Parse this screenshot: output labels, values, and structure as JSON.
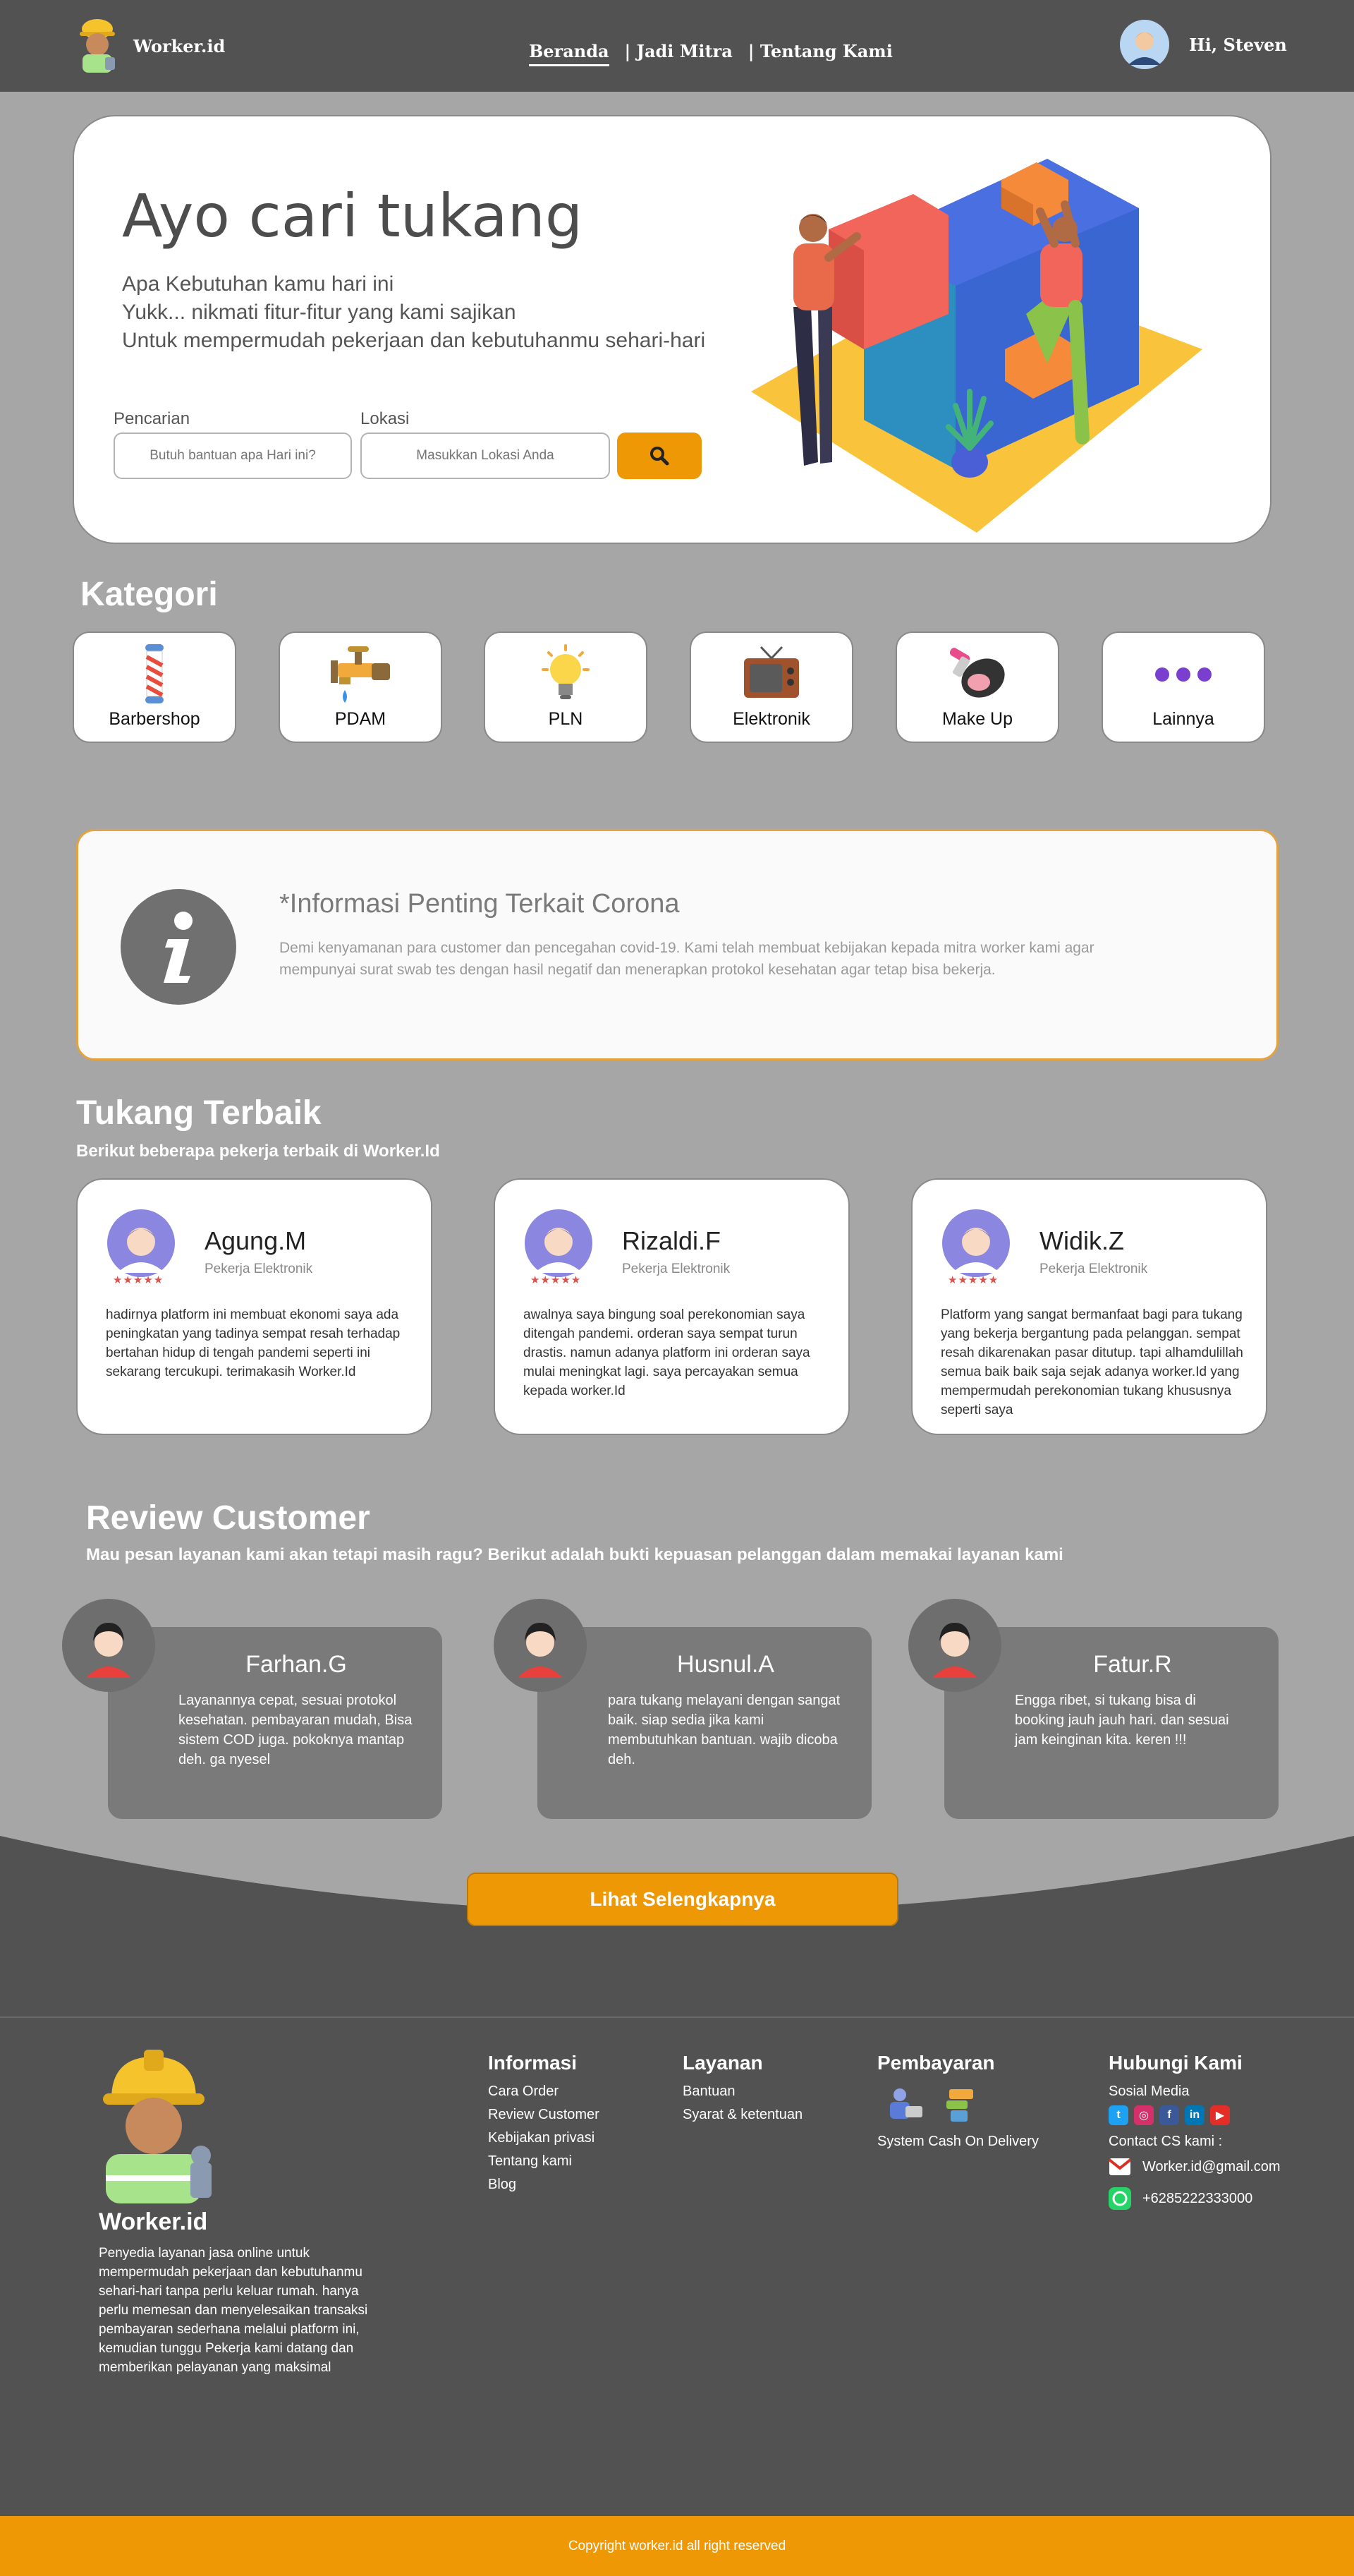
{
  "nav": {
    "brand": "Worker.id",
    "links": [
      "Beranda",
      "| Jadi Mitra",
      "| Tentang Kami"
    ],
    "greeting": "Hi, Steven"
  },
  "hero": {
    "title": "Ayo cari tukang",
    "lines": [
      "Apa Kebutuhan kamu hari ini",
      "Yukk... nikmati fitur-fitur yang kami sajikan",
      "Untuk mempermudah pekerjaan dan kebutuhanmu sehari-hari"
    ],
    "search_label": "Pencarian",
    "location_label": "Lokasi",
    "search_placeholder": "Butuh bantuan apa Hari ini?",
    "location_placeholder": "Masukkan Lokasi Anda",
    "search_button_icon": "search-icon"
  },
  "kategori": {
    "title": "Kategori",
    "items": [
      {
        "label": "Barbershop",
        "icon": "barber-pole-icon"
      },
      {
        "label": "PDAM",
        "icon": "water-tap-icon"
      },
      {
        "label": "PLN",
        "icon": "light-bulb-icon"
      },
      {
        "label": "Elektronik",
        "icon": "television-icon"
      },
      {
        "label": "Make Up",
        "icon": "makeup-icon"
      },
      {
        "label": "Lainnya",
        "icon": "more-dots-icon"
      }
    ]
  },
  "info": {
    "icon": "info-icon",
    "title": "*Informasi Penting Terkait Corona",
    "text": "Demi kenyamanan para customer dan pencegahan covid-19. Kami telah membuat kebijakan kepada mitra worker kami agar mempunyai surat swab tes dengan hasil negatif dan menerapkan protokol kesehatan agar tetap bisa bekerja."
  },
  "tukang": {
    "title": "Tukang Terbaik",
    "subtitle": "Berikut beberapa pekerja terbaik di Worker.Id",
    "rating_display": "★★★★★",
    "items": [
      {
        "name": "Agung.M",
        "role": "Pekerja Elektronik",
        "text": "hadirnya platform ini membuat ekonomi saya ada peningkatan yang tadinya sempat resah terhadap bertahan hidup di tengah pandemi seperti ini sekarang tercukupi. terimakasih Worker.Id"
      },
      {
        "name": "Rizaldi.F",
        "role": "Pekerja Elektronik",
        "text": "awalnya saya bingung soal perekonomian saya ditengah pandemi. orderan saya sempat turun drastis. namun adanya platform ini orderan saya mulai meningkat lagi. saya percayakan semua kepada worker.Id"
      },
      {
        "name": "Widik.Z",
        "role": "Pekerja Elektronik",
        "text": "Platform yang sangat bermanfaat bagi para tukang yang bekerja bergantung pada pelanggan. sempat resah dikarenakan pasar ditutup. tapi alhamdulillah semua baik baik saja sejak adanya worker.Id yang mempermudah perekonomian tukang khususnya seperti saya"
      }
    ]
  },
  "review": {
    "title": "Review Customer",
    "subtitle": "Mau pesan layanan kami akan tetapi masih ragu? Berikut adalah bukti kepuasan pelanggan dalam memakai layanan kami",
    "items": [
      {
        "name": "Farhan.G",
        "text": "Layanannya cepat, sesuai protokol kesehatan. pembayaran mudah, Bisa sistem COD juga. pokoknya mantap deh. ga nyesel"
      },
      {
        "name": "Husnul.A",
        "text": "para tukang melayani dengan sangat baik. siap sedia jika kami membutuhkan bantuan. wajib dicoba deh."
      },
      {
        "name": "Fatur.R",
        "text": "Engga ribet, si tukang bisa di booking jauh jauh hari. dan sesuai jam keinginan kita. keren !!!"
      }
    ],
    "more_button": "Lihat Selengkapnya"
  },
  "footer": {
    "brand": "Worker.id",
    "description": "Penyedia layanan jasa online untuk mempermudah pekerjaan dan kebutuhanmu sehari-hari tanpa perlu keluar rumah. hanya perlu memesan dan menyelesaikan transaksi pembayaran sederhana melalui platform ini, kemudian tunggu Pekerja kami datang dan memberikan pelayanan yang maksimal",
    "informasi": {
      "title": "Informasi",
      "links": [
        "Cara Order",
        "Review Customer",
        "Kebijakan privasi",
        "Tentang kami",
        "Blog"
      ]
    },
    "layanan": {
      "title": "Layanan",
      "links": [
        "Bantuan",
        "Syarat & ketentuan"
      ]
    },
    "pembayaran": {
      "title": "Pembayaran",
      "text": "System Cash On Delivery"
    },
    "hubungi": {
      "title": "Hubungi Kami",
      "social_label": "Sosial Media",
      "social_icons": [
        "twitter-icon",
        "instagram-icon",
        "facebook-icon",
        "linkedin-icon",
        "youtube-icon"
      ],
      "cs_label": "Contact CS kami :",
      "email": "Worker.id@gmail.com",
      "phone": "+6285222333000"
    },
    "copyright": "Copyright worker.id all right reserved"
  },
  "colors": {
    "accent": "#ee9806",
    "dark": "#525252",
    "background": "#a6a6a6"
  }
}
